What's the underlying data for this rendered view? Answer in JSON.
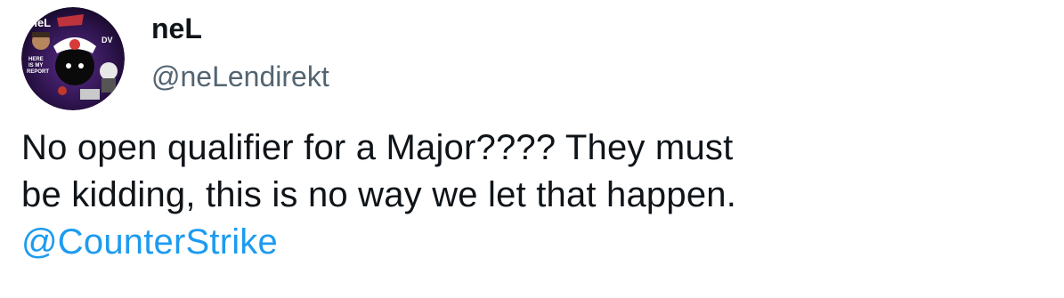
{
  "tweet": {
    "author": {
      "display_name": "neL",
      "handle": "@neLendirekt",
      "avatar": {
        "icon": "profile-avatar",
        "logo_text": "neL",
        "badge_text": "DV",
        "side_text_1": "HERE",
        "side_text_2": "IS MY",
        "side_text_3": "REPORT"
      }
    },
    "text_line_1": "No open qualifier for a Major???? They must",
    "text_line_2": "be kidding, this is no way we let that happen.",
    "mention": "@CounterStrike"
  },
  "colors": {
    "text": "#0f1419",
    "secondary": "#536471",
    "link": "#1d9bf0",
    "avatar_bg": "#3a1a5c"
  }
}
